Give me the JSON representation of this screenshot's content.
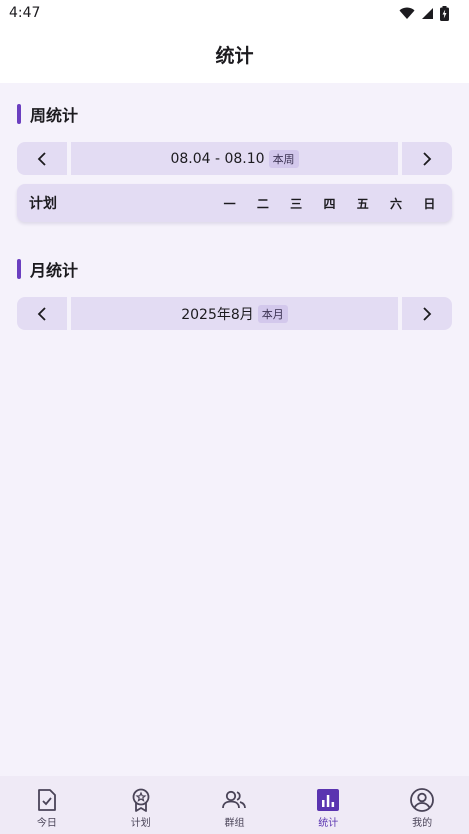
{
  "status_bar": {
    "time": "4:47"
  },
  "header": {
    "title": "统计"
  },
  "week_section": {
    "title": "周统计",
    "range_label": "08.04 - 08.10",
    "range_tag": "本周",
    "table_header": "计划",
    "days": [
      "一",
      "二",
      "三",
      "四",
      "五",
      "六",
      "日"
    ]
  },
  "month_section": {
    "title": "月统计",
    "range_label": "2025年8月",
    "range_tag": "本月"
  },
  "bottom_nav": {
    "tabs": [
      {
        "label": "今日",
        "icon": "today-checklist-icon"
      },
      {
        "label": "计划",
        "icon": "plan-badge-icon"
      },
      {
        "label": "群组",
        "icon": "group-icon"
      },
      {
        "label": "统计",
        "icon": "stats-bar-chart-icon"
      },
      {
        "label": "我的",
        "icon": "profile-icon"
      }
    ],
    "active_index": 3
  },
  "colors": {
    "accent": "#6B3FC0",
    "background": "#F5F2FB",
    "control_bg": "#E3DCF3"
  }
}
